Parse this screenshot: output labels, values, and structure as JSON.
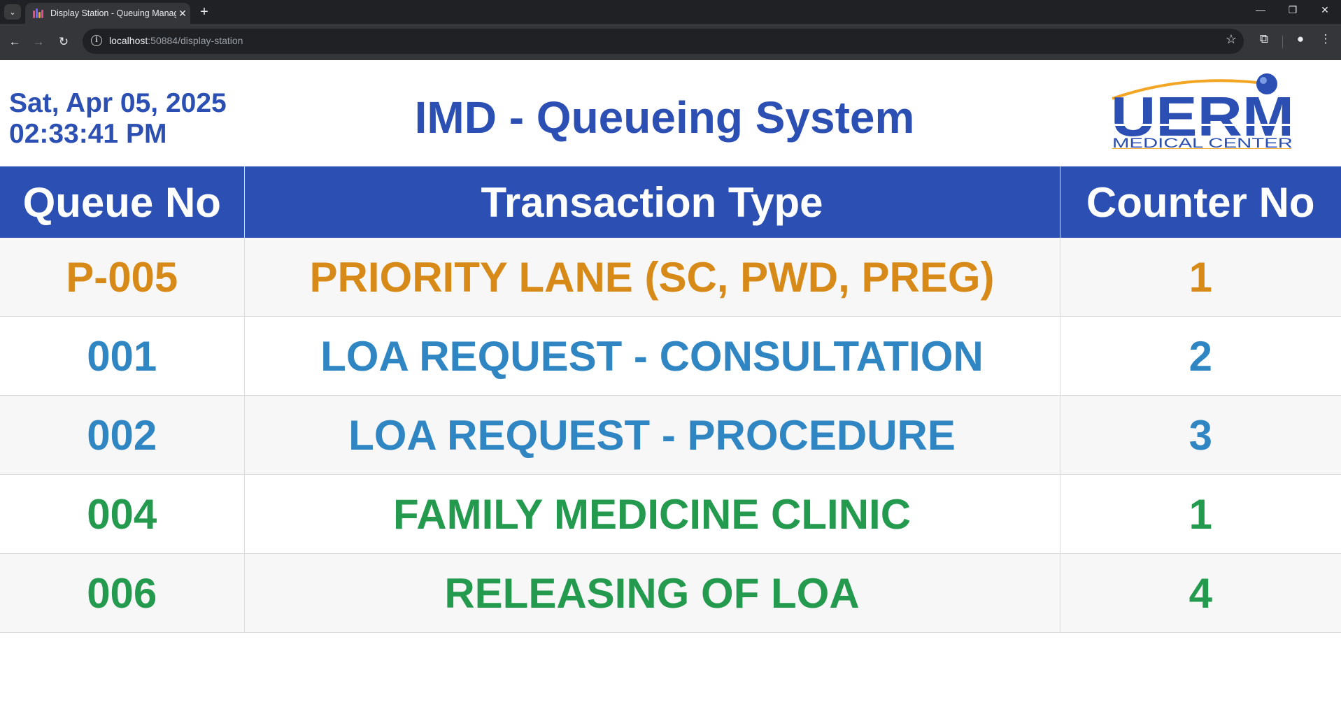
{
  "browser": {
    "tab_title": "Display Station - Queuing Management",
    "url_host": "localhost",
    "url_rest": ":50884/display-station"
  },
  "header": {
    "date": "Sat, Apr 05, 2025",
    "time": "02:33:41 PM",
    "title": "IMD - Queueing System",
    "logo_text_main": "UERM",
    "logo_text_sub": "MEDICAL CENTER"
  },
  "table": {
    "columns": [
      "Queue No",
      "Transaction Type",
      "Counter No"
    ],
    "rows": [
      {
        "queue": "P-005",
        "type": "PRIORITY LANE (SC, PWD, PREG)",
        "counter": "1",
        "color": "#d88a18"
      },
      {
        "queue": "001",
        "type": "LOA REQUEST - CONSULTATION",
        "counter": "2",
        "color": "#2f86c3"
      },
      {
        "queue": "002",
        "type": "LOA REQUEST - PROCEDURE",
        "counter": "3",
        "color": "#2f86c3"
      },
      {
        "queue": "004",
        "type": "FAMILY MEDICINE CLINIC",
        "counter": "1",
        "color": "#249a4f"
      },
      {
        "queue": "006",
        "type": "RELEASING OF LOA",
        "counter": "4",
        "color": "#249a4f"
      }
    ]
  },
  "colors": {
    "primary": "#2b4fb3",
    "priority": "#d88a18",
    "loa": "#2f86c3",
    "clinic": "#249a4f"
  }
}
